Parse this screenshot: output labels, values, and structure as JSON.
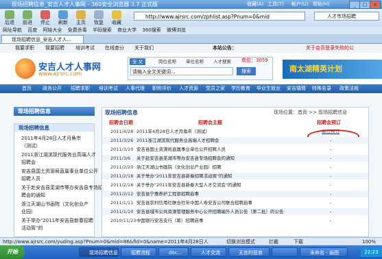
{
  "browser": {
    "title": "现场招聘信息_安吉人才人事网 - 360安全浏览器 3.7 正式版",
    "menus": [
      "收藏(A)",
      "工具(T)",
      "帐户(U)",
      "帮助(H)"
    ],
    "nav_buttons": [
      "后退",
      "前进",
      "停止",
      "刷新",
      "主页",
      "恢复",
      "收藏"
    ],
    "address": "http://www.ajrsrc.com/zphlist.asp?Pnum=0&mid",
    "search_engine_value": "人才市场招聘",
    "favorites": [
      "网址导航",
      "百度",
      "阿娃大全",
      "免费杀毒",
      "半码搜索",
      "商业大学",
      "360搜索",
      "微博浏览"
    ],
    "tab": "现场招聘信息_安吉人才人..."
  },
  "site": {
    "top_links": [
      "我要求职",
      "我要招聘",
      "培训考试",
      "在线查分",
      "关于我们"
    ],
    "notice_label": "本站公告：",
    "notice_right": "关于会员登录失败的公",
    "logo_name": "安吉人才人事网",
    "logo_url": "www.ajrsrc.com",
    "search_tabs": [
      "全 文",
      "岗位名称",
      "单位名称",
      "人才搜索"
    ],
    "search_placeholder": "请输入全文关键词...",
    "search_button": "搜索",
    "hot_label": "岗位：3059",
    "banner_text": "南太湖精英计划",
    "main_nav": [
      "首页",
      "政务公开",
      "招聘求职",
      "培训考试",
      "人事代理",
      "职称评价",
      "人才资源",
      "党员之家",
      "学历教育",
      "毕业生就业",
      "安吉镇情",
      "特殊名录",
      "政策法规"
    ]
  },
  "left_panel": {
    "title": "现场招聘信息",
    "box_title": "现场招聘信息",
    "lines": [
      "2011年4月28日人才月角市",
      "（测试）",
      "2011浙江湖滨现代服务业高端人才",
      "招聘会",
      "安吉县国土资源局直属事业单位公开",
      "招聘人员",
      "关于赴安吉县芜湖市等办安吉县专场招",
      "聘会的通知",
      "浙江天湖山书画院（文化创业产",
      "业园）",
      "关于举办\"2011年安吉县新春招聘",
      "活动周\"的"
    ]
  },
  "right_panel": {
    "title": "现场招聘信息",
    "breadcrumb": "现场位置：首页 >> 现场招聘信息",
    "col_date": "招聘会日期",
    "col_subject": "招聘会主题",
    "col_action": "招聘会预订",
    "rows": [
      {
        "date": "2011/4/28",
        "subject": "2011年4月28日人才月角市（测试）",
        "action": "展位预订"
      },
      {
        "date": "2011/3/26",
        "subject": "2011浙江湖滨现代服务业高端人才招聘会",
        "action": "-"
      },
      {
        "date": "2011/3/10",
        "subject": "安吉县国土资源局直属事业单位公开招聘人员",
        "action": "-"
      },
      {
        "date": "2011/3/6",
        "subject": "关于赴安吉县芜湖市等办安吉县专场招聘会的通知",
        "action": "-"
      },
      {
        "date": "2011/2/20",
        "subject": "浙江天湖山书画院（文化创业产业园）招聘",
        "action": "-"
      },
      {
        "date": "2011/2/18",
        "subject": "关于举办\"2011年安吉县新春招聘活动周\"的通知",
        "action": "-"
      },
      {
        "date": "2011/2/16",
        "subject": "关于举办\"2011年安吉县新春大型人才交流会\"的通知",
        "action": "-"
      },
      {
        "date": "2011/2/12",
        "subject": "安吉县宁惠养护工程部招聘启事",
        "action": "-"
      },
      {
        "date": "2011/1/11",
        "subject": "安吉县农村信用社联合社年中国人寿安吉公司联合招聘启事",
        "action": "-"
      },
      {
        "date": "2011/1/10",
        "subject": "安吉县城市公共资源管理服务中心公开招聘编外人员公告（第二批）的公告",
        "action": "-"
      },
      {
        "date": "2010/11/23",
        "subject": "中国银行安吉支行（筹）招聘启事",
        "action": "-"
      }
    ]
  },
  "status_bar": {
    "url": "http://www.ajrsrc.com/yuding.asp?Pnum=0&mid=86&fid=0&name=2011年4月28日人才月角市（测试）",
    "items": [
      "切换浏览模式",
      "拦截",
      "下载",
      "100%"
    ]
  },
  "taskbar": {
    "start": "开始",
    "buttons": [
      "现场招聘信息",
      "招聘流程",
      "doc...",
      "人才交流",
      "无言的悲哀",
      "",
      "未命名 - 画图"
    ],
    "clock": "22:23"
  }
}
